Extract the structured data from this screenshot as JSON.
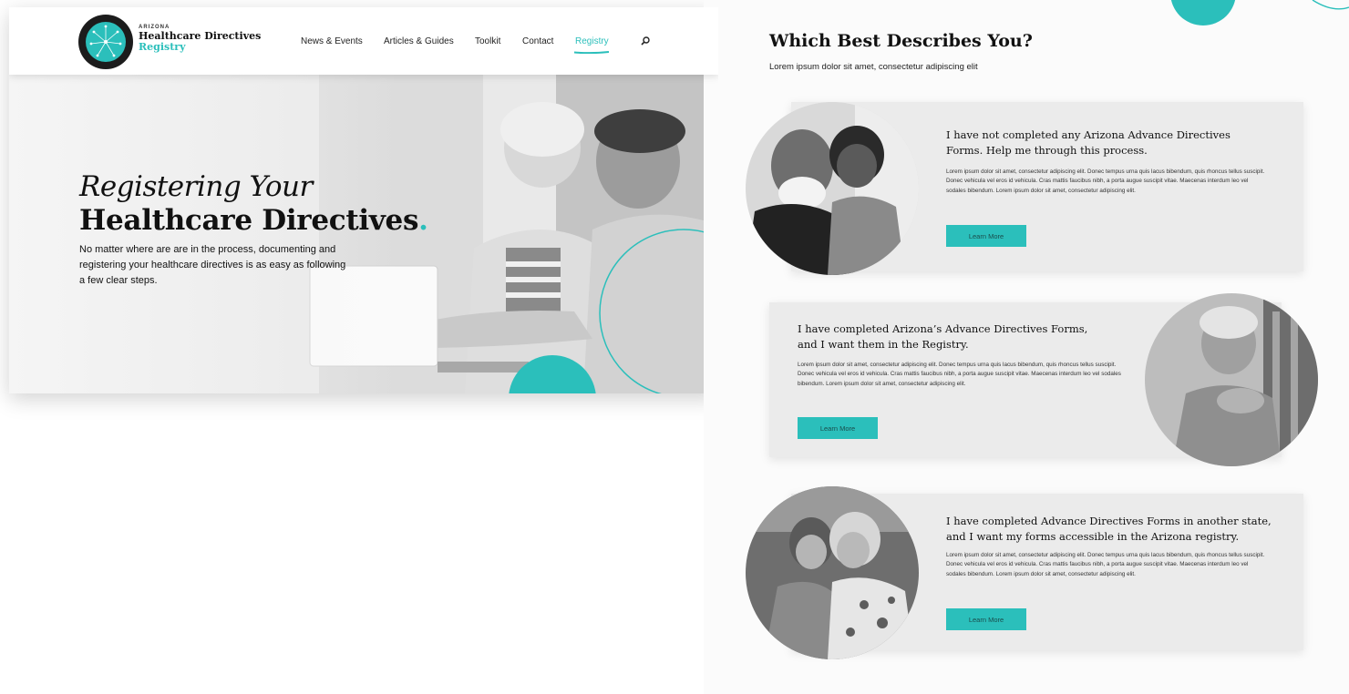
{
  "brand": {
    "state_label": "ARIZONA",
    "line1": "Healthcare Directives",
    "line2": "Registry",
    "accent_color": "#2bbfbb"
  },
  "nav": {
    "items": [
      {
        "label": "News & Events",
        "active": false
      },
      {
        "label": "Articles & Guides",
        "active": false
      },
      {
        "label": "Toolkit",
        "active": false
      },
      {
        "label": "Contact",
        "active": false
      },
      {
        "label": "Registry",
        "active": true
      }
    ],
    "search_icon": "search-icon"
  },
  "hero": {
    "title_line1": "Registering Your",
    "title_line2": "Healthcare Directives",
    "title_dot": ".",
    "body": "No matter where are are in the process, documenting and registering your healthcare directives is as easy as following a few clear steps."
  },
  "selector": {
    "title": "Which Best Describes You?",
    "subtitle": "Lorem ipsum dolor sit amet, consectetur adipiscing elit",
    "cards": [
      {
        "heading": "I have not completed any Arizona Advance Directives Forms. Help me through this process.",
        "body": "Lorem ipsum dolor sit amet, consectetur adipiscing elit. Donec tempus urna quis lacus bibendum, quis rhoncus tellus suscipit. Donec vehicula vel eros id vehicula. Cras mattis faucibus nibh, a porta augue suscipit vitae. Maecenas interdum leo vel sodales bibendum. Lorem ipsum dolor sit amet, consectetur adipiscing elit.",
        "button": "Learn More"
      },
      {
        "heading": "I have completed Arizona’s Advance Directives Forms, and I want them in the Registry.",
        "body": "Lorem ipsum dolor sit amet, consectetur adipiscing elit. Donec tempus urna quis lacus bibendum, quis rhoncus tellus suscipit. Donec vehicula vel eros id vehicula. Cras mattis faucibus nibh, a porta augue suscipit vitae. Maecenas interdum leo vel sodales bibendum. Lorem ipsum dolor sit amet, consectetur adipiscing elit.",
        "button": "Learn More"
      },
      {
        "heading": "I have completed Advance Directives Forms in another state, and I want my forms accessible in the Arizona registry.",
        "body": "Lorem ipsum dolor sit amet, consectetur adipiscing elit. Donec tempus urna quis lacus bibendum, quis rhoncus tellus suscipit. Donec vehicula vel eros id vehicula. Cras mattis faucibus nibh, a porta augue suscipit vitae. Maecenas interdum leo vel sodales bibendum. Lorem ipsum dolor sit amet, consectetur adipiscing elit.",
        "button": "Learn More"
      }
    ]
  }
}
